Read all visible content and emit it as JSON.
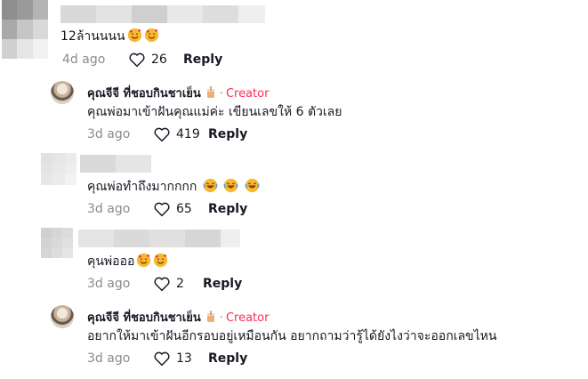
{
  "comments": [
    {
      "text": "12ล้านนนน",
      "date": "4d ago",
      "likes": "26",
      "reply_label": "Reply",
      "emojis": [
        "smiling-face-with-hearts-icon",
        "smiling-face-with-hearts-icon"
      ]
    },
    {
      "username": "คุณจีจี ที่ชอบกินชาเย็น",
      "creator_label": "Creator",
      "separator": "·",
      "text": "คุณพ่อมาเข้าฝันคุณแม่ค่ะ เขียนเลขให้ 6 ตัวเลย",
      "date": "3d ago",
      "likes": "419",
      "reply_label": "Reply"
    },
    {
      "text": "คุณพ่อทำถึงมากกกก",
      "date": "3d ago",
      "likes": "65",
      "reply_label": "Reply",
      "emojis": [
        "laughing-face-icon",
        "laughing-face-icon",
        "laughing-face-icon"
      ]
    },
    {
      "text": "คุนพ่อออ",
      "date": "3d ago",
      "likes": "2",
      "reply_label": "Reply",
      "emojis": [
        "smiling-face-with-hearts-icon",
        "smiling-face-with-hearts-icon"
      ]
    },
    {
      "username": "คุณจีจี ที่ชอบกินชาเย็น",
      "creator_label": "Creator",
      "separator": "·",
      "text": "อยากให้มาเข้าฝันอีกรอบอยู่เหมือนกัน อยากถามว่ารู้ได้ยังไงว่าจะออกเลขไหน",
      "date": "3d ago",
      "likes": "13",
      "reply_label": "Reply"
    }
  ],
  "colors": {
    "creator": "#fe2c55",
    "meta": "#8a8b91",
    "text": "#161823"
  }
}
